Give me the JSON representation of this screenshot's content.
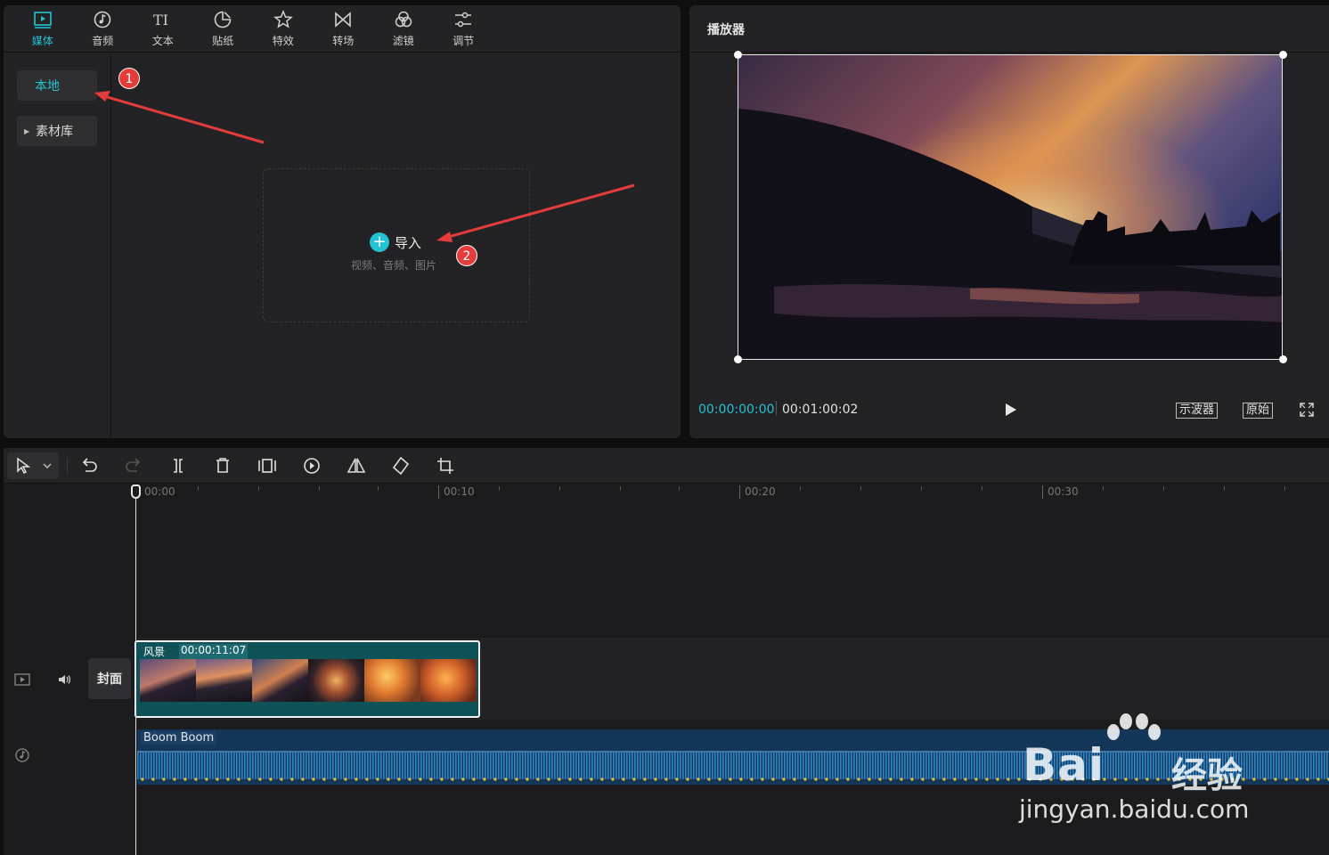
{
  "media_tabs": [
    {
      "label": "媒体",
      "icon": "media-icon",
      "active": true
    },
    {
      "label": "音频",
      "icon": "audio-icon"
    },
    {
      "label": "文本",
      "icon": "text-icon"
    },
    {
      "label": "贴纸",
      "icon": "sticker-icon"
    },
    {
      "label": "特效",
      "icon": "effects-icon"
    },
    {
      "label": "转场",
      "icon": "transition-icon"
    },
    {
      "label": "滤镜",
      "icon": "filter-icon"
    },
    {
      "label": "调节",
      "icon": "adjust-icon"
    }
  ],
  "sidebar": {
    "local": "本地",
    "library": "素材库"
  },
  "import": {
    "label": "导入",
    "hint": "视频、音频、图片"
  },
  "player": {
    "title": "播放器",
    "current_time": "00:00:00:00",
    "total_time": "00:01:00:02",
    "scope_label": "示波器",
    "original_label": "原始"
  },
  "timeline": {
    "ruler_labels": [
      "00:00",
      "00:10",
      "00:20",
      "00:30"
    ],
    "cover_label": "封面",
    "video_clip": {
      "name": "风景",
      "duration": "00:00:11:07"
    },
    "audio_clip": {
      "name": "Boom Boom"
    }
  },
  "annotations": {
    "marker1": "1",
    "marker2": "2"
  },
  "watermark": {
    "brand": "Bai",
    "cn": "经验",
    "url": "jingyan.baidu.com"
  },
  "colors": {
    "accent": "#22c3d3",
    "marker": "#e43b3b",
    "video_clip": "#0f5257",
    "audio_clip": "#143759"
  }
}
